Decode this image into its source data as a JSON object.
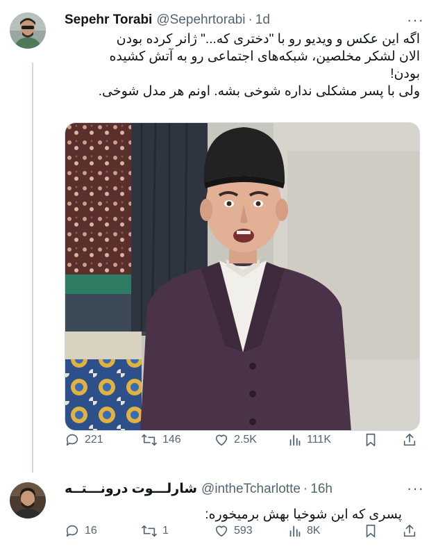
{
  "tweet": {
    "author_name": "Sepehr Torabi",
    "handle": "@Sepehrtorabi",
    "separator": "·",
    "time": "1d",
    "more": "···",
    "text_lines": [
      "اگه این عکس و ویدیو رو با \"دختری که...\" ژانر کرده بودن",
      "الان لشکر مخلصین، شبکه‌های اجتماعی رو به آتش کشیده",
      "بودن!",
      "ولی با پسر مشکلی نداره شوخی بشه. اونم هر مدل شوخی."
    ],
    "stats": {
      "replies": "221",
      "retweets": "146",
      "likes": "2.5K",
      "views": "111K"
    }
  },
  "reply": {
    "author_name": "شارلـــوت درونـــتــه",
    "handle": "@intheTcharlotte",
    "separator": "·",
    "time": "16h",
    "more": "···",
    "text": "پسری که این شوخیا بهش برمیخوره:",
    "stats": {
      "replies": "16",
      "retweets": "1",
      "likes": "593",
      "views": "8K"
    }
  },
  "colors": {
    "text": "#0f1419",
    "secondary": "#536471",
    "border": "#cfd9de",
    "coat": "#4a3348"
  }
}
